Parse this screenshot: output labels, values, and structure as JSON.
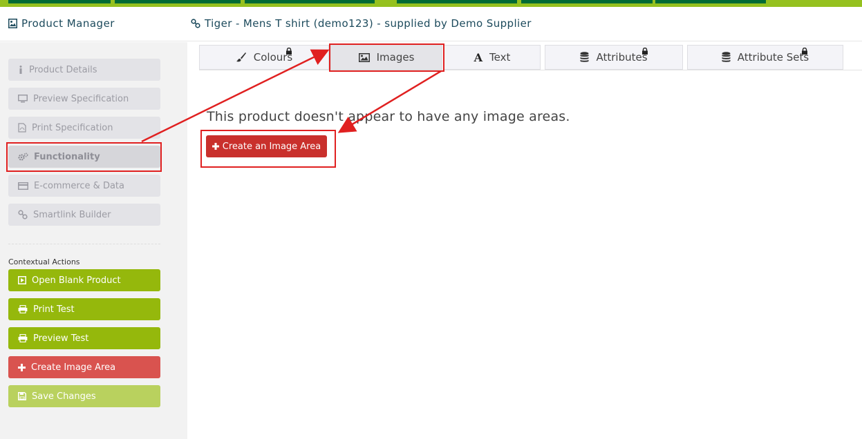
{
  "header": {
    "app_title": "Product Manager",
    "page_title": "Tiger - Mens T shirt (demo123) - supplied by Demo Supplier"
  },
  "sidebar": {
    "nav": [
      {
        "label": "Product Details",
        "icon": "info-icon"
      },
      {
        "label": "Preview Specification",
        "icon": "monitor-icon"
      },
      {
        "label": "Print Specification",
        "icon": "pdf-file-icon"
      },
      {
        "label": "Functionality",
        "icon": "cogs-icon",
        "active": true
      },
      {
        "label": "E-commerce & Data",
        "icon": "credit-card-icon"
      },
      {
        "label": "Smartlink Builder",
        "icon": "link-icon"
      }
    ],
    "contextual_label": "Contextual Actions",
    "actions": [
      {
        "label": "Open Blank Product",
        "icon": "play-square-icon"
      },
      {
        "label": "Print Test",
        "icon": "printer-icon"
      },
      {
        "label": "Preview Test",
        "icon": "printer-icon"
      },
      {
        "label": "Create Image Area",
        "icon": "plus-icon"
      },
      {
        "label": "Save Changes",
        "icon": "floppy-icon"
      }
    ]
  },
  "tabs": [
    {
      "label": "Colours",
      "icon": "paintbrush-icon",
      "locked": true
    },
    {
      "label": "Images",
      "icon": "image-icon",
      "locked": false,
      "active": true
    },
    {
      "label": "Text",
      "icon": "font-icon",
      "locked": false
    },
    {
      "label": "Attributes",
      "icon": "database-icon",
      "locked": true
    },
    {
      "label": "Attribute Sets",
      "icon": "database-icon",
      "locked": true
    }
  ],
  "main": {
    "message": "This product doesn't appear to have any image areas.",
    "create_button": "Create an Image Area"
  },
  "colors": {
    "brand_green": "#95c11f",
    "dark_green": "#006b35",
    "action_green": "#95b80c",
    "danger_red": "#c9302c",
    "highlight_red": "#e02020"
  }
}
